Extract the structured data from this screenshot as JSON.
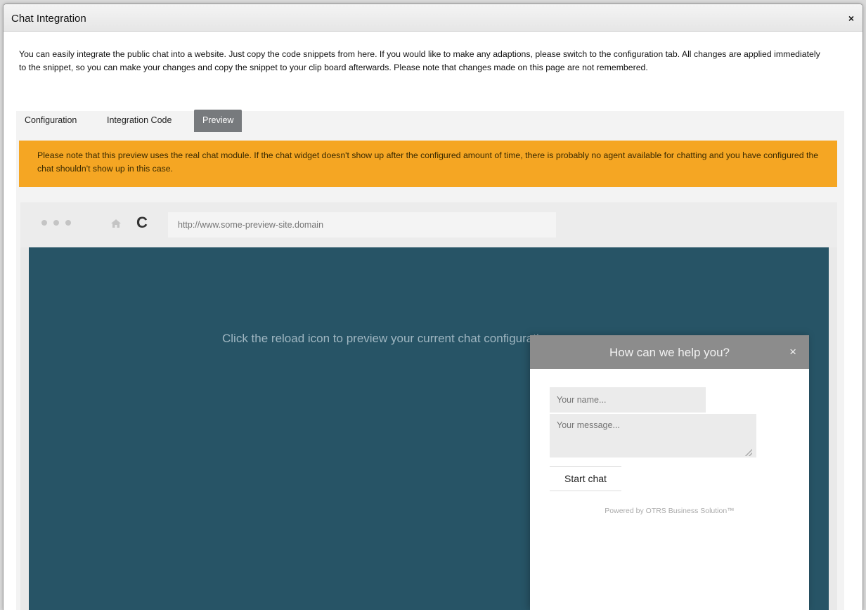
{
  "dialog": {
    "title": "Chat Integration",
    "close_label": "×",
    "intro": "You can easily integrate the public chat into a website. Just copy the code snippets from here. If you would like to make any adaptions, please switch to the configuration tab. All changes are applied immediately to the snippet, so you can make your changes and copy the snippet to your clip board afterwards. Please note that changes made on this page are not remembered."
  },
  "tabs": [
    {
      "label": "Configuration",
      "active": false
    },
    {
      "label": "Integration Code",
      "active": false
    },
    {
      "label": "Preview",
      "active": true
    }
  ],
  "notice": {
    "text": "Please note that this preview uses the real chat module. If the chat widget doesn't show up after the configured amount of time, there is probably no agent available for chatting and you have configured the chat shouldn't show up in this case.",
    "color": "#f5a623"
  },
  "browser": {
    "url_placeholder": "http://www.some-preview-site.domain",
    "reload_icon": "reload-icon",
    "home_icon": "home-icon"
  },
  "site": {
    "message": "Click the reload icon to preview your current chat configuration",
    "background_color": "#275466"
  },
  "chat": {
    "header": "How can we help you?",
    "close_label": "×",
    "name_placeholder": "Your name...",
    "message_placeholder": "Your message...",
    "start_button": "Start chat",
    "powered_by": "Powered by OTRS Business Solution™"
  }
}
